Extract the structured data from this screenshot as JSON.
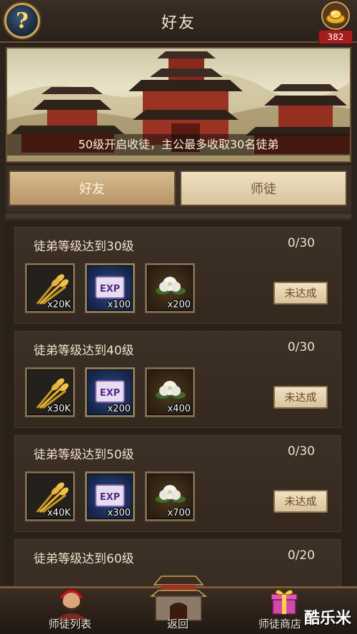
{
  "header": {
    "title": "好友",
    "help_glyph": "?",
    "gold_count": "382"
  },
  "banner": {
    "caption": "50级开启收徒，主公最多收取30名徒弟"
  },
  "tabs": [
    {
      "label": "好友",
      "active": false
    },
    {
      "label": "师徒",
      "active": true
    }
  ],
  "rewards": [
    {
      "title": "徒弟等级达到30级",
      "progress": "0/30",
      "status": "未达成",
      "items": [
        {
          "icon": "wheat-icon",
          "qty": "x20K"
        },
        {
          "icon": "exp-scroll-icon",
          "qty": "x100"
        },
        {
          "icon": "white-flower-icon",
          "qty": "x200"
        }
      ]
    },
    {
      "title": "徒弟等级达到40级",
      "progress": "0/30",
      "status": "未达成",
      "items": [
        {
          "icon": "wheat-icon",
          "qty": "x30K"
        },
        {
          "icon": "exp-scroll-icon",
          "qty": "x200"
        },
        {
          "icon": "white-flower-icon",
          "qty": "x400"
        }
      ]
    },
    {
      "title": "徒弟等级达到50级",
      "progress": "0/30",
      "status": "未达成",
      "items": [
        {
          "icon": "wheat-icon",
          "qty": "x40K"
        },
        {
          "icon": "exp-scroll-icon",
          "qty": "x300"
        },
        {
          "icon": "white-flower-icon",
          "qty": "x700"
        }
      ]
    },
    {
      "title": "徒弟等级达到60级",
      "progress": "0/20"
    }
  ],
  "bottom_nav": {
    "left_label": "师徒列表",
    "center_label": "返回",
    "right_label": "师徒商店"
  },
  "watermark": "酷乐米",
  "colors": {
    "accent_gold": "#c9a45a",
    "badge_red": "#a51d1d"
  }
}
